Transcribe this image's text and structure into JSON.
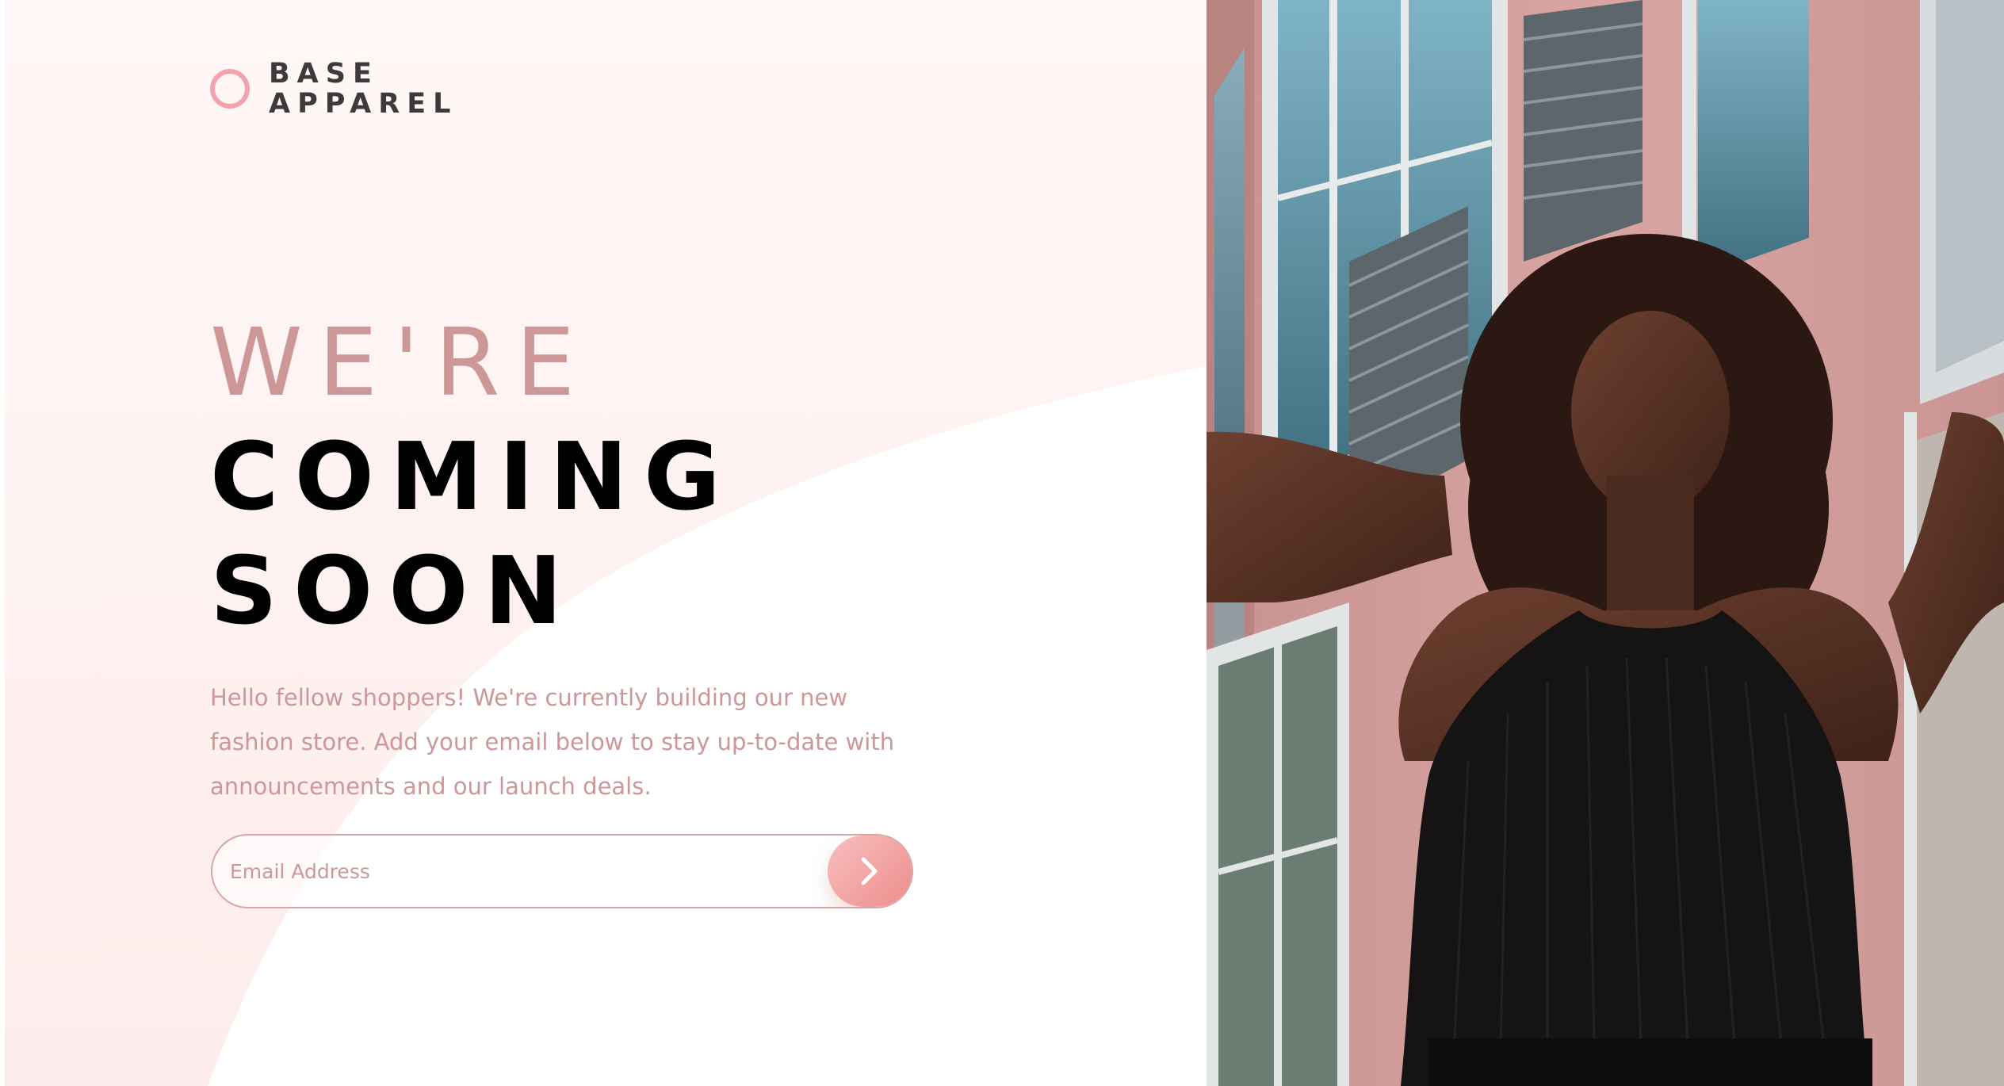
{
  "brand": {
    "line1": "BASE",
    "line2": "APPAREL"
  },
  "headline": {
    "light": "WE'RE",
    "bold_line1": "COMING",
    "bold_line2": "SOON"
  },
  "intro": {
    "text": "Hello fellow shoppers! We're currently building our new fashion store. Add your email below to stay up-to-date with announcements and our launch deals."
  },
  "form": {
    "email_placeholder": "Email Address",
    "email_value": "",
    "submit_icon": "chevron-right-icon"
  },
  "colors": {
    "accent_pink": "#ce9797",
    "dark_text": "#3e3a3b",
    "button_gradient_start": "#f8bfbf",
    "button_gradient_end": "#ee8c8c",
    "background_tint": "#fdf1f1"
  },
  "hero": {
    "image_subject": "woman-with-curly-hair-photo"
  }
}
